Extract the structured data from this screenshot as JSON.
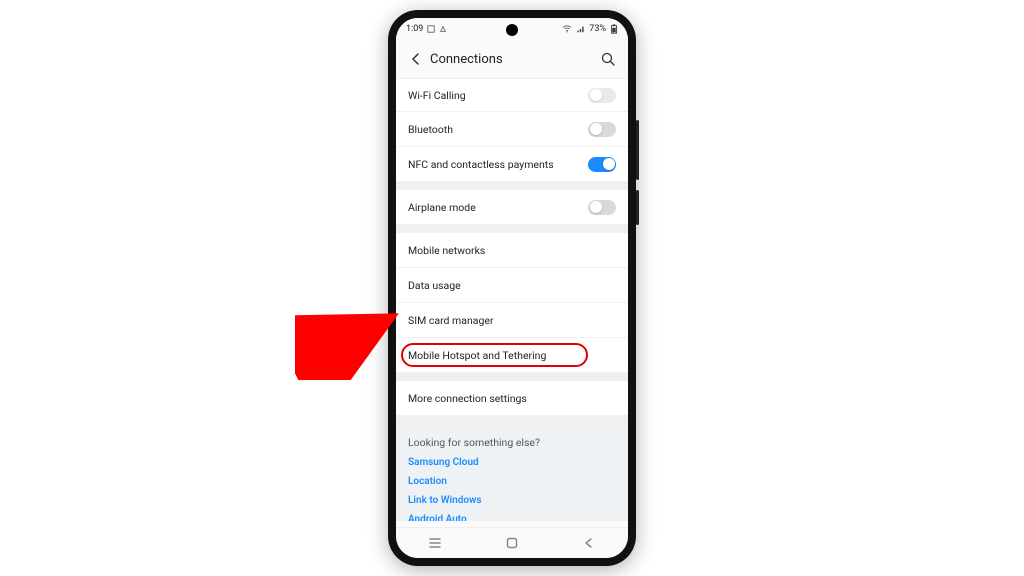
{
  "statusbar": {
    "time": "1:09",
    "battery_text": "73%"
  },
  "header": {
    "title": "Connections"
  },
  "rows": {
    "wifi_calling": "Wi-Fi Calling",
    "bluetooth": "Bluetooth",
    "nfc": "NFC and contactless payments",
    "airplane": "Airplane mode",
    "mobile_networks": "Mobile networks",
    "data_usage": "Data usage",
    "sim_manager": "SIM card manager",
    "hotspot": "Mobile Hotspot and Tethering",
    "more_settings": "More connection settings"
  },
  "footer": {
    "heading": "Looking for something else?",
    "link1": "Samsung Cloud",
    "link2": "Location",
    "link3": "Link to Windows",
    "link4": "Android Auto"
  },
  "toggles": {
    "wifi_calling": "off",
    "bluetooth": "off",
    "nfc": "on",
    "airplane": "off"
  },
  "annotation": {
    "highlight_target": "hotspot",
    "arrow_color": "#ff0000"
  }
}
